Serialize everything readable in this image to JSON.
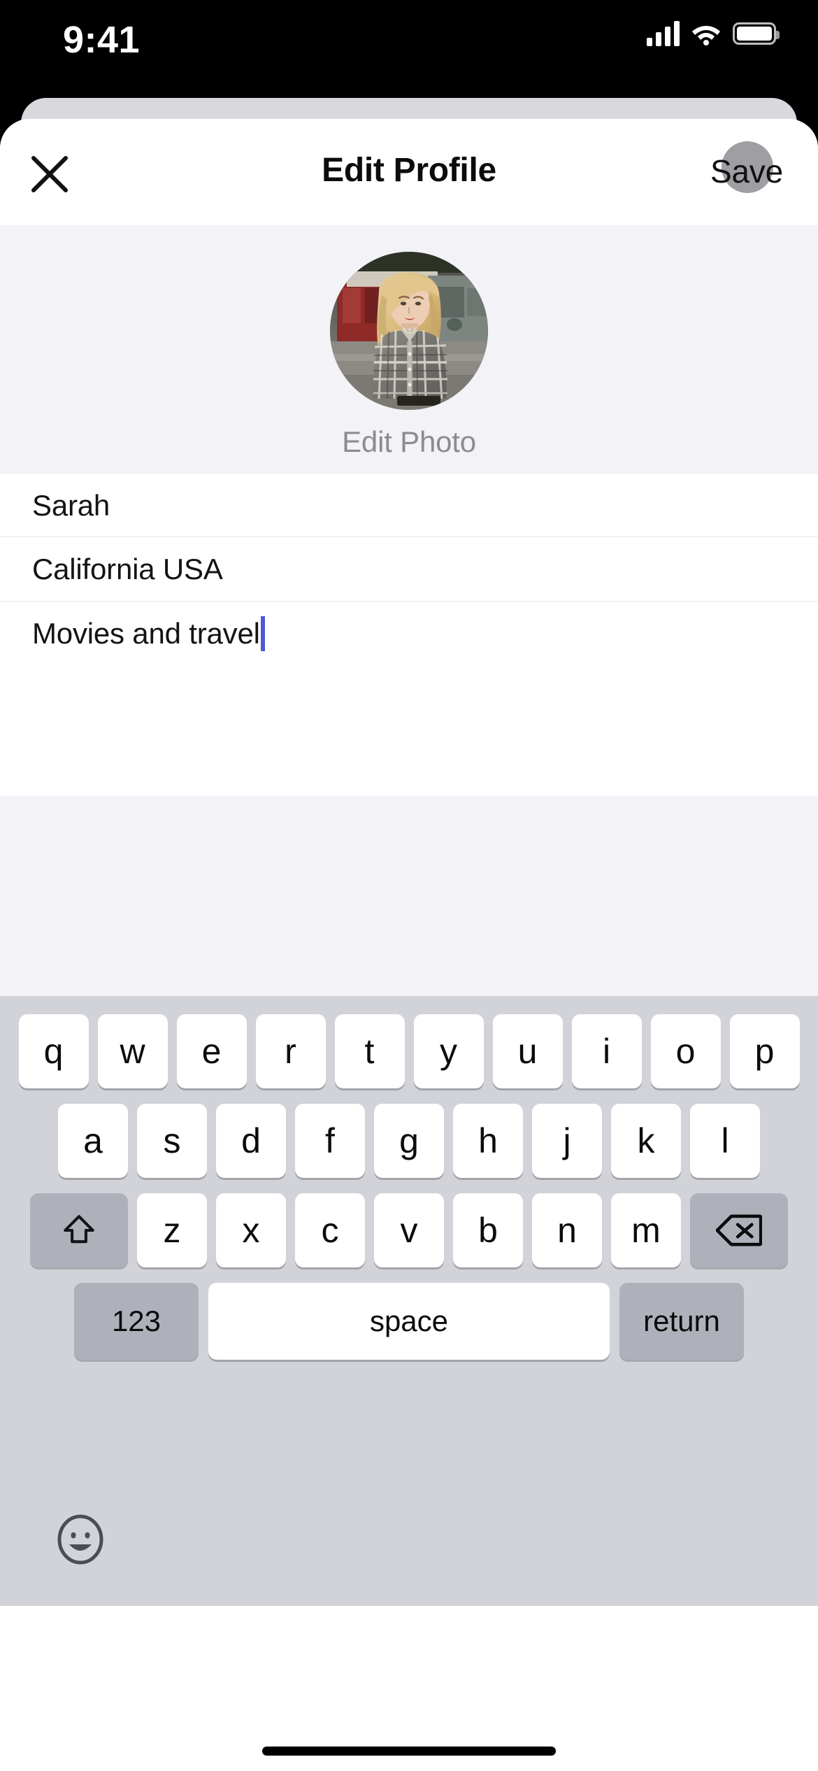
{
  "status_bar": {
    "time": "9:41",
    "signal_icon": "cellular-signal-icon",
    "wifi_icon": "wifi-icon",
    "battery_icon": "battery-icon"
  },
  "nav": {
    "close_icon": "close-x-icon",
    "title": "Edit Profile",
    "save_label": "Save",
    "tap_indicator": "tap-indicator-dot"
  },
  "photo": {
    "avatar_alt": "user-profile-photo",
    "edit_photo_label": "Edit Photo"
  },
  "form": {
    "fields": [
      {
        "name": "name",
        "value": "Sarah",
        "has_caret": false
      },
      {
        "name": "location",
        "value": "California USA",
        "has_caret": false
      },
      {
        "name": "interests",
        "value": "Movies and travel",
        "has_caret": true
      }
    ]
  },
  "keyboard": {
    "row1": [
      "q",
      "w",
      "e",
      "r",
      "t",
      "y",
      "u",
      "i",
      "o",
      "p"
    ],
    "row2": [
      "a",
      "s",
      "d",
      "f",
      "g",
      "h",
      "j",
      "k",
      "l"
    ],
    "row3_letters": [
      "z",
      "x",
      "c",
      "v",
      "b",
      "n",
      "m"
    ],
    "shift_icon": "shift-arrow-icon",
    "delete_icon": "delete-backspace-icon",
    "numbers_label": "123",
    "space_label": "space",
    "return_label": "return",
    "emoji_icon": "emoji-smiley-icon"
  },
  "colors": {
    "accent_caret": "#4f5bd5",
    "section_bg": "#f2f2f7",
    "keyboard_bg": "#d1d3d9",
    "key_bg": "#ffffff",
    "modifier_key_bg": "#aeb1ba",
    "muted_text": "#8b8b90"
  }
}
